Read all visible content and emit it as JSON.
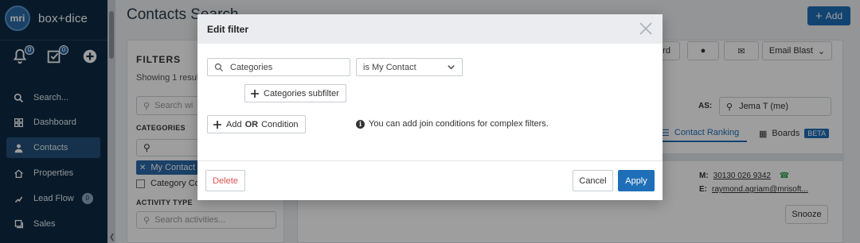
{
  "brand": {
    "logo_text": "mri",
    "name": "box+dice"
  },
  "sidebar": {
    "notifications_count": "0",
    "tasks_count": "0",
    "items": [
      {
        "label": "Search..."
      },
      {
        "label": "Dashboard"
      },
      {
        "label": "Contacts"
      },
      {
        "label": "Properties"
      },
      {
        "label": "Lead Flow",
        "count": "0"
      },
      {
        "label": "Sales"
      }
    ]
  },
  "page": {
    "title": "Contacts Search",
    "add_label": "Add"
  },
  "filters": {
    "title": "FILTERS",
    "showing": "Showing 1 resul",
    "search_placeholder": "Search wi",
    "categories_heading": "CATEGORIES",
    "chip_label": "My Contact",
    "checkbox_label": "Category Co",
    "activity_heading": "ACTIVITY TYPE",
    "activity_placeholder": "Search activities..."
  },
  "results": {
    "toolbar_partial": "ard",
    "email_blast": "Email Blast",
    "as_label": "AS:",
    "as_value": "Jema T (me)",
    "tab_ranking": "Contact Ranking",
    "tab_boards": "Boards",
    "beta": "BETA",
    "mobile_label": "M:",
    "mobile": "30130 026 9342",
    "email_label": "E:",
    "email": "raymond.agriam@mrisoft...",
    "snooze": "Snooze"
  },
  "modal": {
    "title": "Edit filter",
    "field_value": "Categories",
    "operator": "is My Contact",
    "subfilter_label": "Categories subfilter",
    "add_label": "Add",
    "or_label": "OR",
    "condition_label": "Condition",
    "info_text": "You can add join conditions for complex filters.",
    "delete_label": "Delete",
    "cancel_label": "Cancel",
    "apply_label": "Apply"
  }
}
